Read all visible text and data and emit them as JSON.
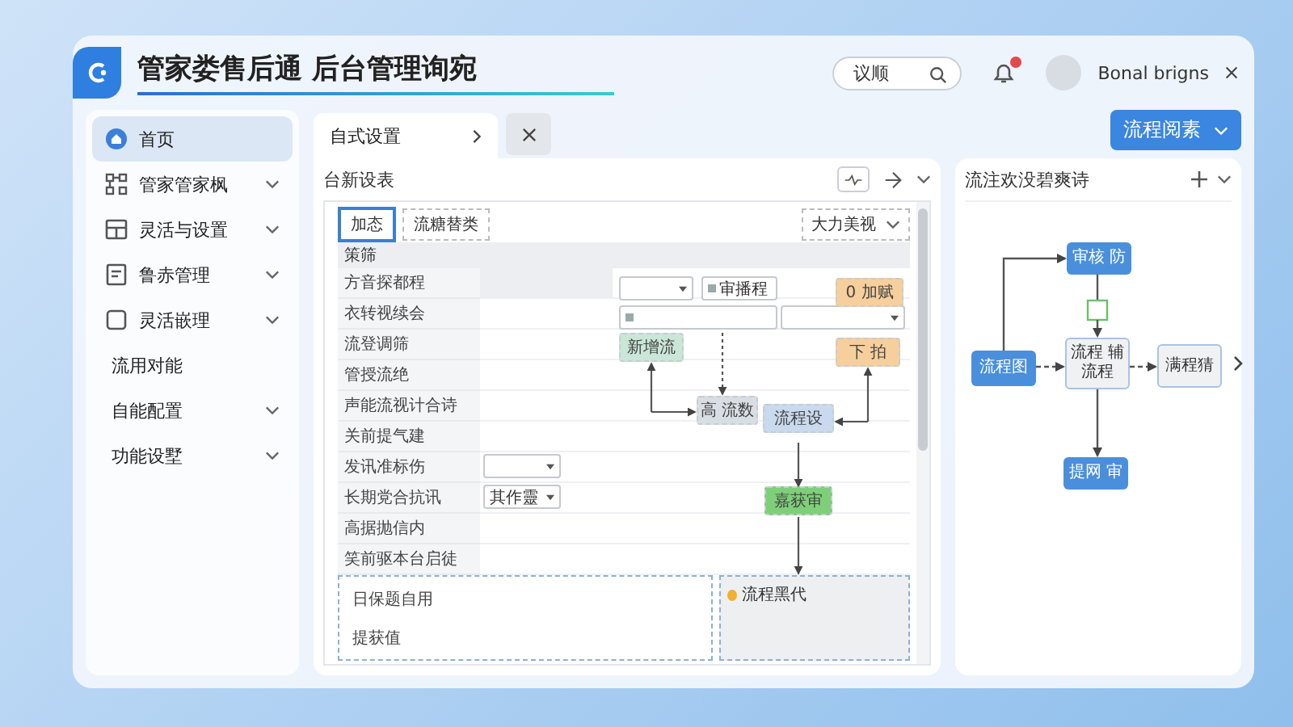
{
  "header": {
    "title": "管家娄售后通 后台管理询宛",
    "search": {
      "placeholder": "议顺"
    },
    "notifications": {
      "unread": true
    },
    "user": {
      "name": "Bonal brigns"
    }
  },
  "sidebar": {
    "items": [
      {
        "label": "首页",
        "selected": true,
        "expandable": false
      },
      {
        "label": "管家管家枫",
        "selected": false,
        "expandable": true
      },
      {
        "label": "灵活与设置",
        "selected": false,
        "expandable": true
      },
      {
        "label": "鲁赤管理",
        "selected": false,
        "expandable": true
      },
      {
        "label": "灵活嵌理",
        "selected": false,
        "expandable": true
      },
      {
        "label": "流用对能",
        "selected": false,
        "expandable": false
      },
      {
        "label": "自能配置",
        "selected": false,
        "expandable": true
      },
      {
        "label": "功能设墅",
        "selected": false,
        "expandable": true
      }
    ]
  },
  "editor": {
    "tab": {
      "label": "自式设置"
    },
    "title": "台新设表",
    "form_tabs": [
      {
        "label": "加态",
        "selected": true
      },
      {
        "label": "流糖替类",
        "selected": false
      }
    ],
    "view_select": {
      "value": "大力美视"
    },
    "table": {
      "header": "策筛",
      "rows": [
        "方音探都程",
        "衣转视续会",
        "流登调筛",
        "管授流绝",
        "声能流视计合诗",
        "关前提气建",
        "发讯准标伤",
        "长期党合抗讯",
        "高据抛信内",
        "笑前驱本台启徒"
      ],
      "footer_rows": [
        "日保题自用",
        "提获值"
      ]
    },
    "fields": [
      {
        "kind": "select"
      },
      {
        "kind": "input",
        "value": "审播程"
      },
      {
        "kind": "input"
      },
      {
        "kind": "select"
      },
      {
        "kind": "select"
      },
      {
        "kind": "select",
        "value": "其作靈"
      }
    ],
    "nodes": [
      {
        "text": "0 加赋",
        "color": "#f6cf9c"
      },
      {
        "text": "新增流",
        "color": "#c9e6d6"
      },
      {
        "text": "下 拍",
        "color": "#f6cf9c"
      },
      {
        "text": "高 流数",
        "color": "#d9dee5"
      },
      {
        "text": "流程设",
        "color": "#c9d9ee"
      },
      {
        "text": "嘉获审",
        "color": "#7fcf7a"
      }
    ],
    "note": {
      "text": "流程黑代"
    }
  },
  "action_button": {
    "label": "流程阅素"
  },
  "flow_panel": {
    "title": "流注欢没碧爽诗",
    "nodes": [
      {
        "text": "审核 防",
        "kind": "primary"
      },
      {
        "text": "流程图",
        "kind": "primary"
      },
      {
        "text": "流程 辅流程",
        "kind": "process"
      },
      {
        "text": "满程猜",
        "kind": "process"
      },
      {
        "text": "提网 审",
        "kind": "primary"
      }
    ]
  }
}
